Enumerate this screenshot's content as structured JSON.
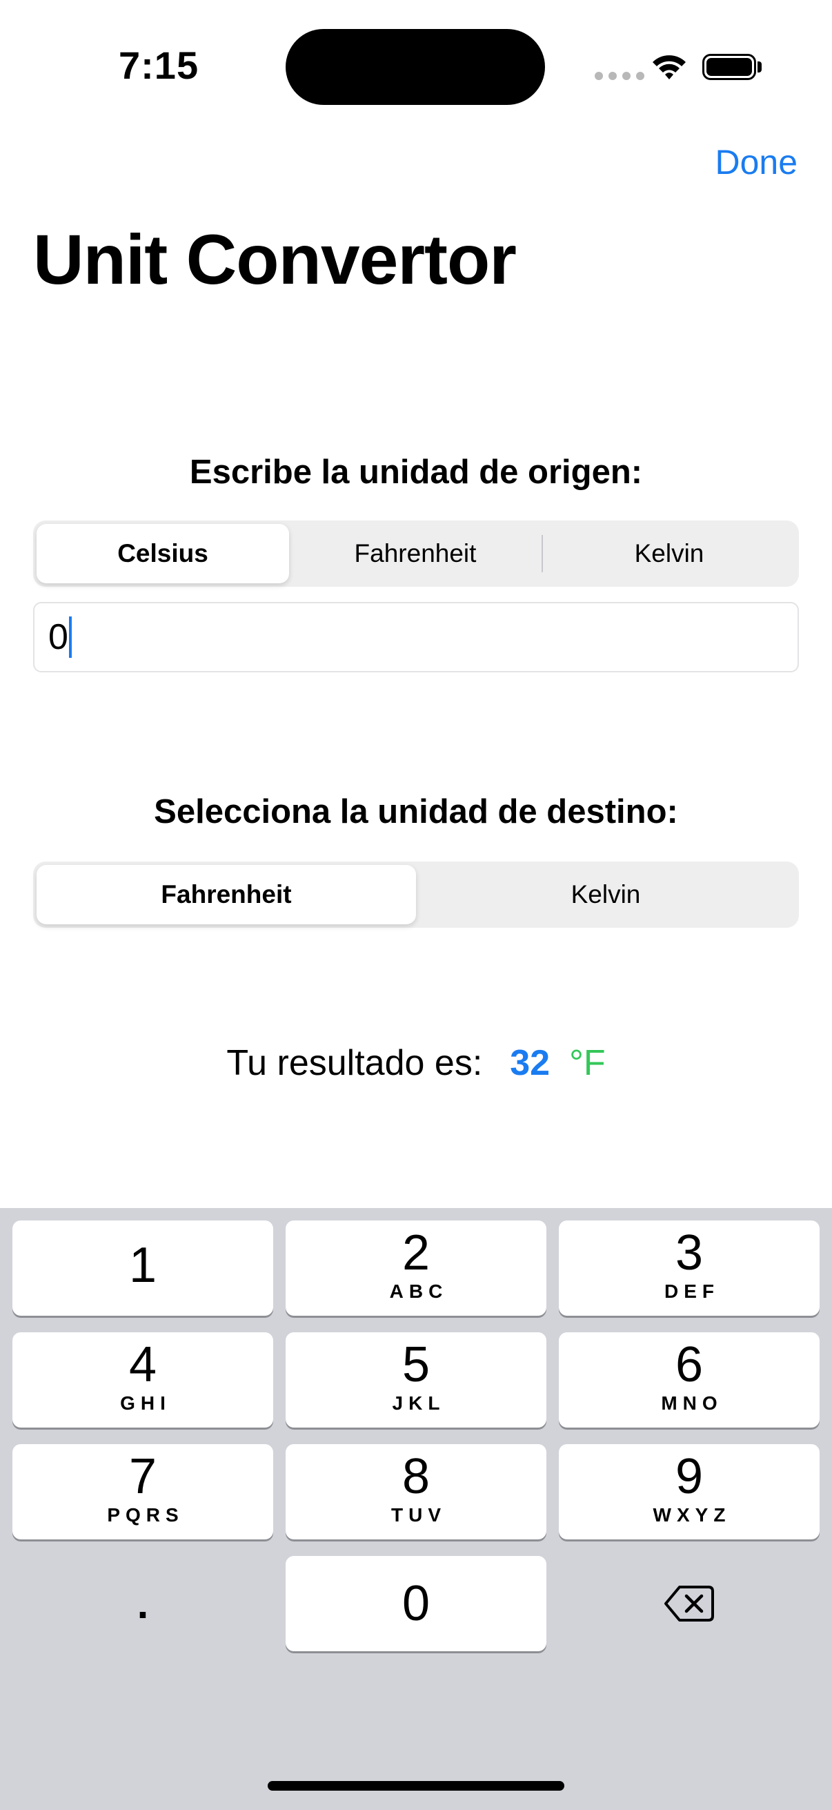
{
  "status_bar": {
    "time": "7:15"
  },
  "nav": {
    "done_label": "Done"
  },
  "title": "Unit Convertor",
  "source": {
    "label": "Escribe la unidad de origen:",
    "options": [
      "Celsius",
      "Fahrenheit",
      "Kelvin"
    ],
    "selected": "Celsius",
    "input_value": "0"
  },
  "target": {
    "label": "Selecciona la unidad de destino:",
    "options": [
      "Fahrenheit",
      "Kelvin"
    ],
    "selected": "Fahrenheit"
  },
  "result": {
    "label": "Tu resultado es:",
    "value": "32",
    "unit": "°F"
  },
  "keyboard": {
    "keys": [
      {
        "digit": "1",
        "letters": ""
      },
      {
        "digit": "2",
        "letters": "ABC"
      },
      {
        "digit": "3",
        "letters": "DEF"
      },
      {
        "digit": "4",
        "letters": "GHI"
      },
      {
        "digit": "5",
        "letters": "JKL"
      },
      {
        "digit": "6",
        "letters": "MNO"
      },
      {
        "digit": "7",
        "letters": "PQRS"
      },
      {
        "digit": "8",
        "letters": "TUV"
      },
      {
        "digit": "9",
        "letters": "WXYZ"
      },
      {
        "digit": "0",
        "letters": ""
      }
    ],
    "decimal": ".",
    "delete_icon": "backspace-icon"
  },
  "colors": {
    "accent": "#1a7cf0",
    "unit": "#34c759",
    "keyboard_bg": "#d1d3d9"
  }
}
